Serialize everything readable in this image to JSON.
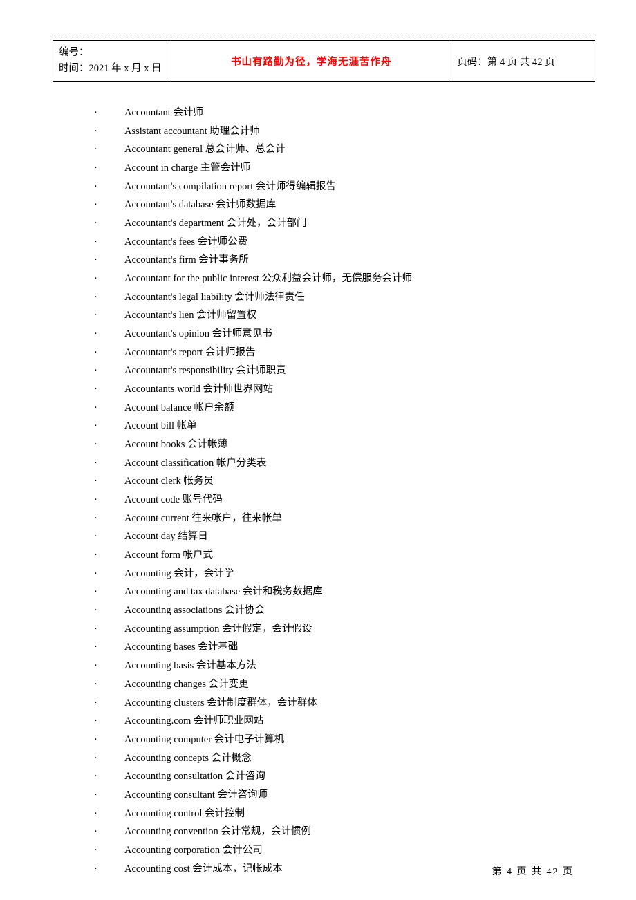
{
  "header": {
    "id_label": "编号：",
    "date_label": "时间：2021 年 x 月 x 日",
    "center_text": "书山有路勤为径，学海无涯苦作舟",
    "page_label": "页码：第 4 页 共 42 页"
  },
  "terms": [
    "Accountant  会计师",
    "Assistant accountant  助理会计师",
    "Accountant general  总会计师、总会计",
    "Account in charge  主管会计师",
    "Accountant's compilation report  会计师得编辑报告",
    "Accountant's database  会计师数据库",
    "Accountant's department  会计处，会计部门",
    "Accountant's fees  会计师公费",
    "Accountant's firm  会计事务所",
    "Accountant for the public interest  公众利益会计师，无偿服务会计师",
    "Accountant's legal liability  会计师法律责任",
    "Accountant's lien  会计师留置权",
    "Accountant's opinion  会计师意见书",
    "Accountant's report 会计师报告",
    "Accountant's responsibility  会计师职责",
    "Accountants world  会计师世界网站",
    "Account balance  帐户余额",
    "Account bill  帐单",
    "Account books  会计帐薄",
    "Account classification  帐户分类表",
    "Account clerk  帐务员",
    "Account code  账号代码",
    "Account current  往来帐户，往来帐单",
    "Account day  结算日",
    "Account form  帐户式",
    "Accounting  会计，会计学",
    "Accounting and tax database  会计和税务数据库",
    "Accounting associations  会计协会",
    "Accounting assumption  会计假定，会计假设",
    "Accounting bases  会计基础",
    "Accounting basis  会计基本方法",
    "Accounting changes  会计变更",
    "Accounting clusters  会计制度群体，会计群体",
    "Accounting.com  会计师职业网站",
    "Accounting computer  会计电子计算机",
    "Accounting concepts  会计概念",
    "Accounting consultation  会计咨询",
    "Accounting consultant  会计咨询师",
    "Accounting control  会计控制",
    "Accounting convention  会计常规，会计惯例",
    "Accounting corporation  会计公司",
    "Accounting cost  会计成本，记帐成本"
  ],
  "footer": {
    "text": "第 4 页 共 42 页"
  }
}
